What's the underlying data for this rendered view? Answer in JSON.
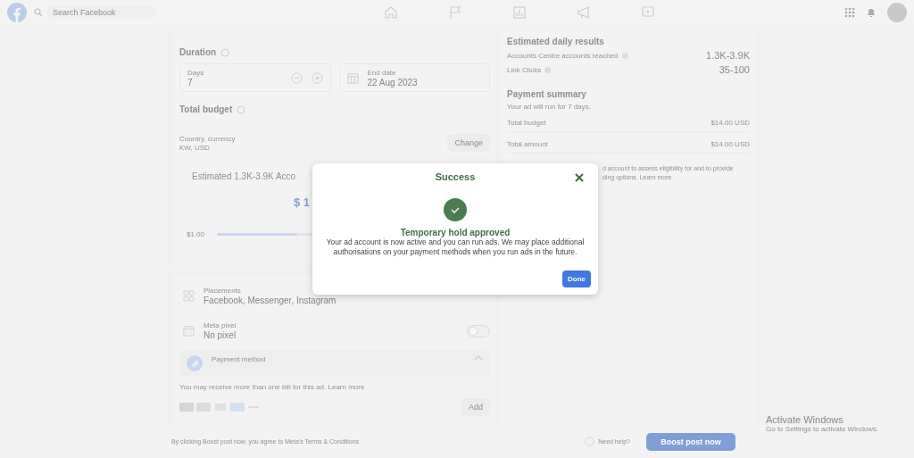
{
  "topbar": {
    "search": {
      "placeholder": "Search Facebook"
    }
  },
  "duration": {
    "title": "Duration",
    "days": {
      "label": "Days",
      "value": "7"
    },
    "end_date": {
      "label": "End date",
      "value": "22 Aug 2023"
    }
  },
  "budget": {
    "title": "Total budget",
    "currency_label": "Country, currency",
    "currency_value": "KW, USD",
    "change_button": "Change",
    "estimate": "Estimated 1.3K-3.9K Acco",
    "amount": "$ 1",
    "min_label": "$1.00",
    "level": 0.3
  },
  "settings": [
    {
      "kind": "info",
      "label": "Placements",
      "value": "Facebook, Messenger, Instagram"
    },
    {
      "kind": "toggle",
      "label": "Meta pixel",
      "value": "No pixel",
      "on": false
    }
  ],
  "payment": {
    "title": "Payment method",
    "expanded": true,
    "note": "You may receive more than one bill for this ad.",
    "link": "Learn more",
    "add_button": "Add"
  },
  "results": {
    "title": "Estimated daily results",
    "rows": [
      {
        "label": "Accounts Centre accounts reached",
        "value": "1.3K-3.9K"
      },
      {
        "label": "Link Clicks",
        "value": "35-100"
      }
    ]
  },
  "summary": {
    "title": "Payment summary",
    "subtitle": "Your ad will run for 7 days.",
    "rows": [
      {
        "label": "Total budget",
        "value": "$14.00 USD"
      },
      {
        "label": "Total amount",
        "value": "$14.00 USD"
      }
    ]
  },
  "notice": [
    "d account to assess eligibility for and to provide",
    "ding options. Learn more"
  ],
  "footer": {
    "terms": "By clicking Boost post now, you agree to Meta's Terms & Conditions",
    "help": "Need help?",
    "boost_button": "Boost post now"
  },
  "modal": {
    "title": "Success",
    "heading": "Temporary hold approved",
    "message": "Your ad account is now active and you can run ads. We may place additional authorisations on your payment methods when you run ads in the future.",
    "done_button": "Done"
  },
  "os_notice": {
    "title": "Activate Windows",
    "subtitle": "Go to Settings to activate Windows."
  }
}
